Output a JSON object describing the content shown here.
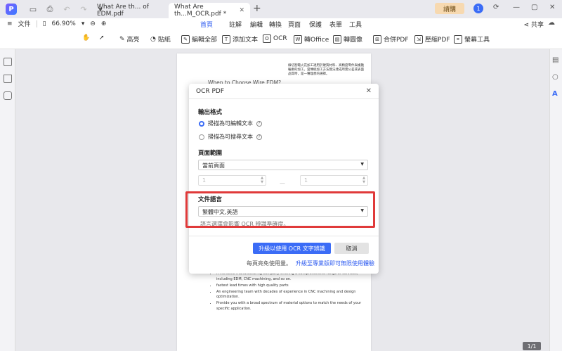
{
  "titlebar": {
    "tab_inactive": "What Are th... of EDM.pdf",
    "tab_active": "What Are th...M_OCR.pdf *",
    "login": "請購",
    "avatar_letter": "1"
  },
  "menubar": {
    "file": "文件",
    "zoom": "66.90%",
    "items": [
      "首頁",
      "註解",
      "編輯",
      "轉換",
      "頁面",
      "保護",
      "表單",
      "工具"
    ],
    "active_index": 0,
    "share": "共享"
  },
  "toolbar": {
    "items": [
      "高亮",
      "貼紙",
      "編輯全部",
      "添加文本",
      "OCR",
      "轉Office",
      "轉圖像",
      "合併PDF",
      "壓縮PDF",
      "螢幕工具"
    ]
  },
  "document": {
    "heading": "When to Choose Wire EDM?",
    "paragraph": "線切割電火花加工適用於硬質材料、高精度零件與複雜輪廓的加工。當傳統加工方法無法達成所需公差或表面品質時，是一種理想的選擇。",
    "bullets": [
      "A versatile manufacturing company offering a comprehensive range of services, including EDM, CNC machining, and so on.",
      "fastest lead times with high quality parts",
      "An engineering team with decades of experience in CNC machining and design optimization.",
      "Provide you with a broad spectrum of material options to match the needs of your specific application."
    ],
    "page_indicator": "1/1"
  },
  "dialog": {
    "title": "OCR PDF",
    "output_label": "輸出格式",
    "option_editable": "掃描為可編輯文本",
    "option_searchable": "掃描為可搜尋文本",
    "selected_option": "editable",
    "range_label": "頁面範圍",
    "range_value": "當前頁面",
    "from_page": "1",
    "to_page": "1",
    "range_separator": "—",
    "language_label": "文件語言",
    "language_value": "繁體中文,英語",
    "language_hint": "語言選擇會影響 OCR 辨識準確度。",
    "primary_button": "升級以使用 OCR 文字辨識",
    "cancel_button": "取消",
    "quota_text": "每頁亮免使用量。",
    "upgrade_link": "升級至專業版即可無限使用體驗"
  },
  "colors": {
    "accent": "#3b6cf6",
    "highlight": "#e03a3a"
  }
}
